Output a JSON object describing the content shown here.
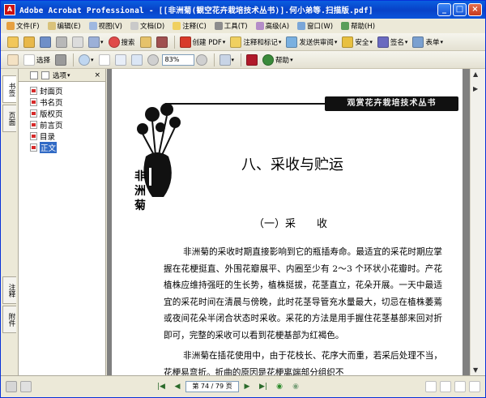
{
  "window": {
    "app_icon_text": "A",
    "title": "Adobe Acrobat Professional - [[非洲菊(観空花卉栽培技术丛书)].何小弟等.扫描版.pdf]",
    "controls": [
      "_",
      "□",
      "×"
    ]
  },
  "menubar": {
    "items": [
      "文件(F)",
      "编辑(E)",
      "视图(V)",
      "文档(D)",
      "注释(C)",
      "工具(T)",
      "高级(A)",
      "窗口(W)",
      "帮助(H)"
    ]
  },
  "toolbar1": {
    "search_label": "搜索",
    "create_pdf_label": "创建 PDF",
    "review_label": "注释和标记",
    "send_review_label": "发送供审阅",
    "secure_label": "安全",
    "sign_label": "签名",
    "forms_label": "表单"
  },
  "toolbar2": {
    "select_label": "选择",
    "zoom_value": "83%",
    "help_label": "帮助"
  },
  "left_tabs": {
    "bookmarks": "书签",
    "pages": "页面",
    "annotations": "注释",
    "attachments": "附件"
  },
  "bookmarks_panel": {
    "options_label": "选项",
    "close": "×",
    "items": [
      {
        "label": "封面页",
        "selected": false
      },
      {
        "label": "书名页",
        "selected": false
      },
      {
        "label": "版权页",
        "selected": false
      },
      {
        "label": "前言页",
        "selected": false
      },
      {
        "label": "目录",
        "selected": false
      },
      {
        "label": "正文",
        "selected": true
      }
    ]
  },
  "page": {
    "book_header": "观赏花卉栽培技术丛书",
    "side_title": [
      "非",
      "洲",
      "菊"
    ],
    "chapter_title": "八、采收与贮运",
    "section_title": "（一）采　　收",
    "paragraph1": "非洲菊的采收时期直接影响到它的瓶插寿命。最适宜的采花时期应掌握在花梗挺直、外围花瓣展平、内圈至少有 2～3 个环状小花瓣时。产花植株应维持强旺的生长势，植株挺拔，花茎直立，花朵开展。一天中最适宜的采花时间在清晨与傍晚，此时花茎导管充水量最大，切忌在植株萎蔫或夜间花朵半闭合状态时采收。采花的方法是用手握住花茎基部来回对折即可，完整的采收可以看到花梗基部为红褐色。",
    "paragraph2": "非洲菊在插花使用中，由于花枝长、花序大而重，若采后处理不当，花梗易弯折。折曲的原因是花梗离端部分组织不"
  },
  "statusbar": {
    "page_indicator": "第 74 / 79 页"
  },
  "colors": {
    "title_bar": "#0a54da",
    "selection": "#316ac5",
    "doc_background": "#808080"
  }
}
